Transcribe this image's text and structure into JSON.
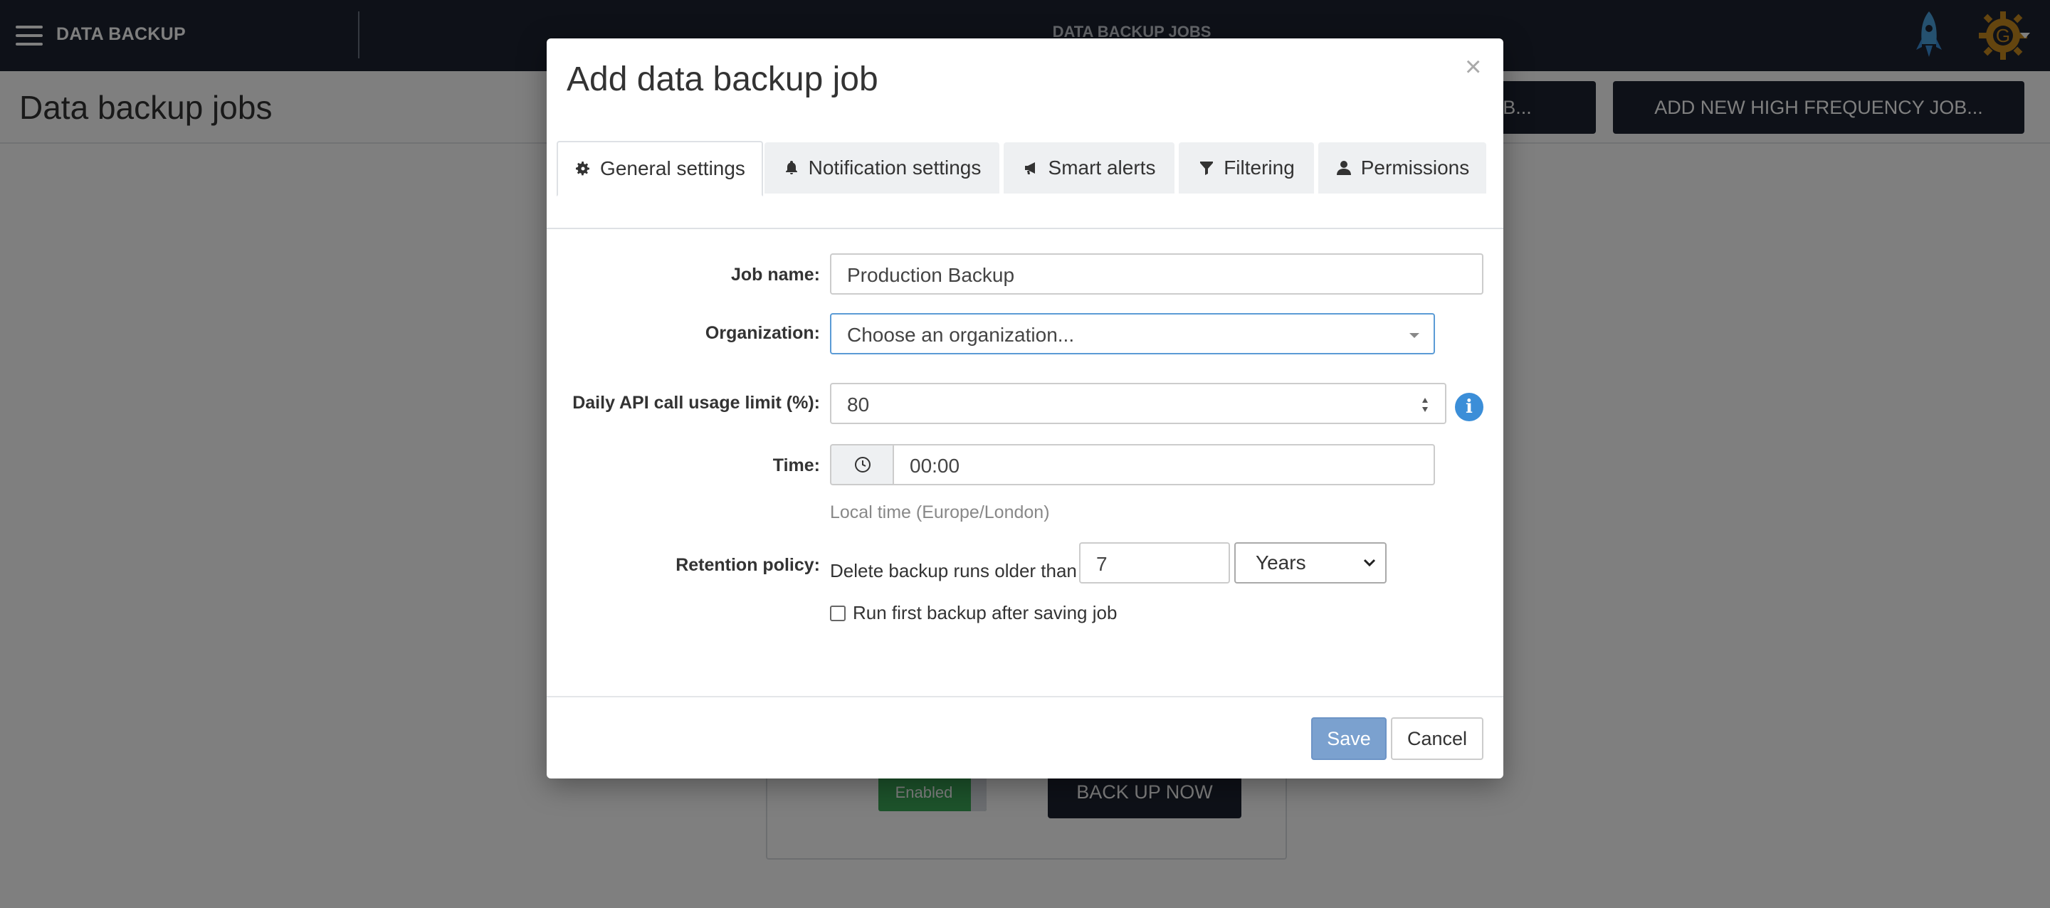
{
  "app": {
    "brand": "DATA BACKUP",
    "top_title": "DATA BACKUP JOBS"
  },
  "page": {
    "title": "Data backup jobs",
    "add_job_button_partial": "OB...",
    "add_high_freq_button": "ADD NEW HIGH FREQUENCY JOB...",
    "job_card": {
      "status_toggle": "Enabled",
      "backup_now_button": "BACK UP NOW"
    }
  },
  "modal": {
    "title": "Add data backup job",
    "close": "×",
    "tabs": [
      {
        "label": "General settings",
        "icon": "gear-icon",
        "active": true
      },
      {
        "label": "Notification settings",
        "icon": "bell-icon",
        "active": false
      },
      {
        "label": "Smart alerts",
        "icon": "megaphone-icon",
        "active": false
      },
      {
        "label": "Filtering",
        "icon": "filter-icon",
        "active": false
      },
      {
        "label": "Permissions",
        "icon": "user-icon",
        "active": false
      }
    ],
    "form": {
      "job_name": {
        "label": "Job name:",
        "value": "Production Backup"
      },
      "organization": {
        "label": "Organization:",
        "value": "Choose an organization..."
      },
      "api_limit": {
        "label": "Daily API call usage limit (%):",
        "value": "80"
      },
      "time": {
        "label": "Time:",
        "value": "00:00",
        "helper": "Local time (Europe/London)"
      },
      "retention": {
        "label": "Retention policy:",
        "prefix": "Delete backup runs older than",
        "amount": "7",
        "unit": "Years"
      },
      "run_first": {
        "label": "Run first backup after saving job",
        "checked": false
      }
    },
    "footer": {
      "save": "Save",
      "cancel": "Cancel"
    }
  },
  "colors": {
    "topbar": "#1d2330",
    "save_button": "#7ba1cf",
    "info_icon": "#3b8ed8",
    "enabled_toggle": "#3aa757"
  }
}
